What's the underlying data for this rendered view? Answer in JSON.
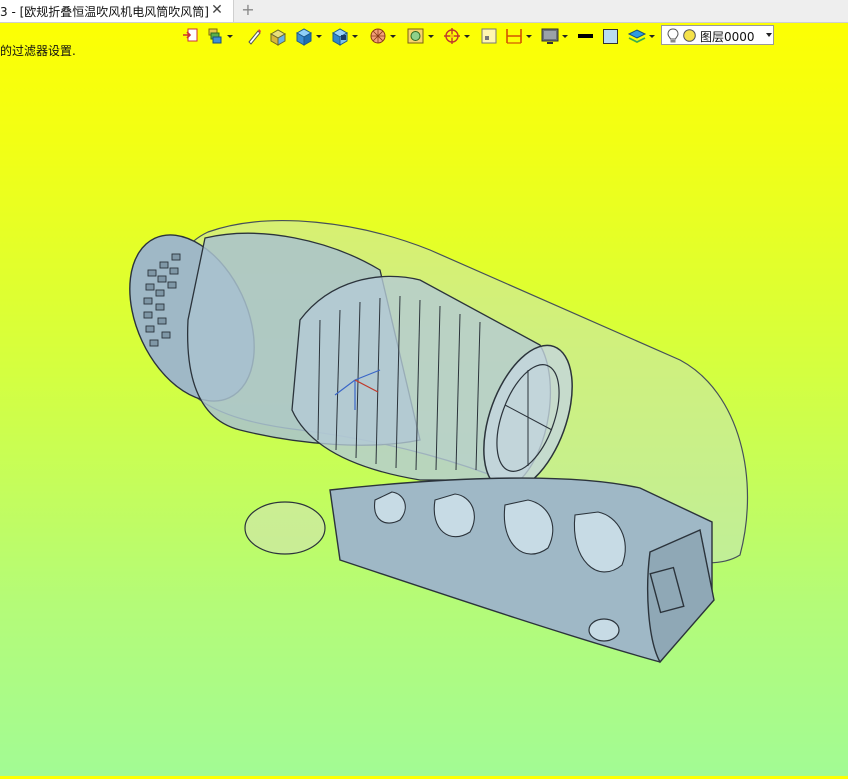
{
  "tab": {
    "title": "3 - [欧规折叠恒温吹风机电风筒吹风筒]",
    "close_symbol": "✕",
    "new_symbol": "+"
  },
  "hint": {
    "text": "的过滤器设置."
  },
  "toolbar": {
    "tools": [
      {
        "name": "import-icon"
      },
      {
        "name": "layers-stack-icon"
      },
      {
        "name": "pen-icon"
      },
      {
        "name": "box-shaded-icon"
      },
      {
        "name": "cube-icon"
      },
      {
        "name": "view-cube-icon"
      },
      {
        "name": "sphere-render-icon"
      },
      {
        "name": "display-mode-icon"
      },
      {
        "name": "axis-icon"
      },
      {
        "name": "select-face-icon"
      },
      {
        "name": "dimension-icon"
      },
      {
        "name": "monitor-icon"
      },
      {
        "name": "line-color-icon"
      },
      {
        "name": "fill-color-icon"
      },
      {
        "name": "layer-stack-icon"
      }
    ],
    "layer": {
      "value": "图层0000",
      "bulb_icon": "bulb-icon",
      "color_icon": "layer-color-icon"
    }
  },
  "viewport": {
    "model": "欧规折叠恒温吹风机电风筒吹风筒",
    "background_top": "#ffff00",
    "background_bottom": "#a2fb94",
    "model_color": "#9fb8c6"
  }
}
